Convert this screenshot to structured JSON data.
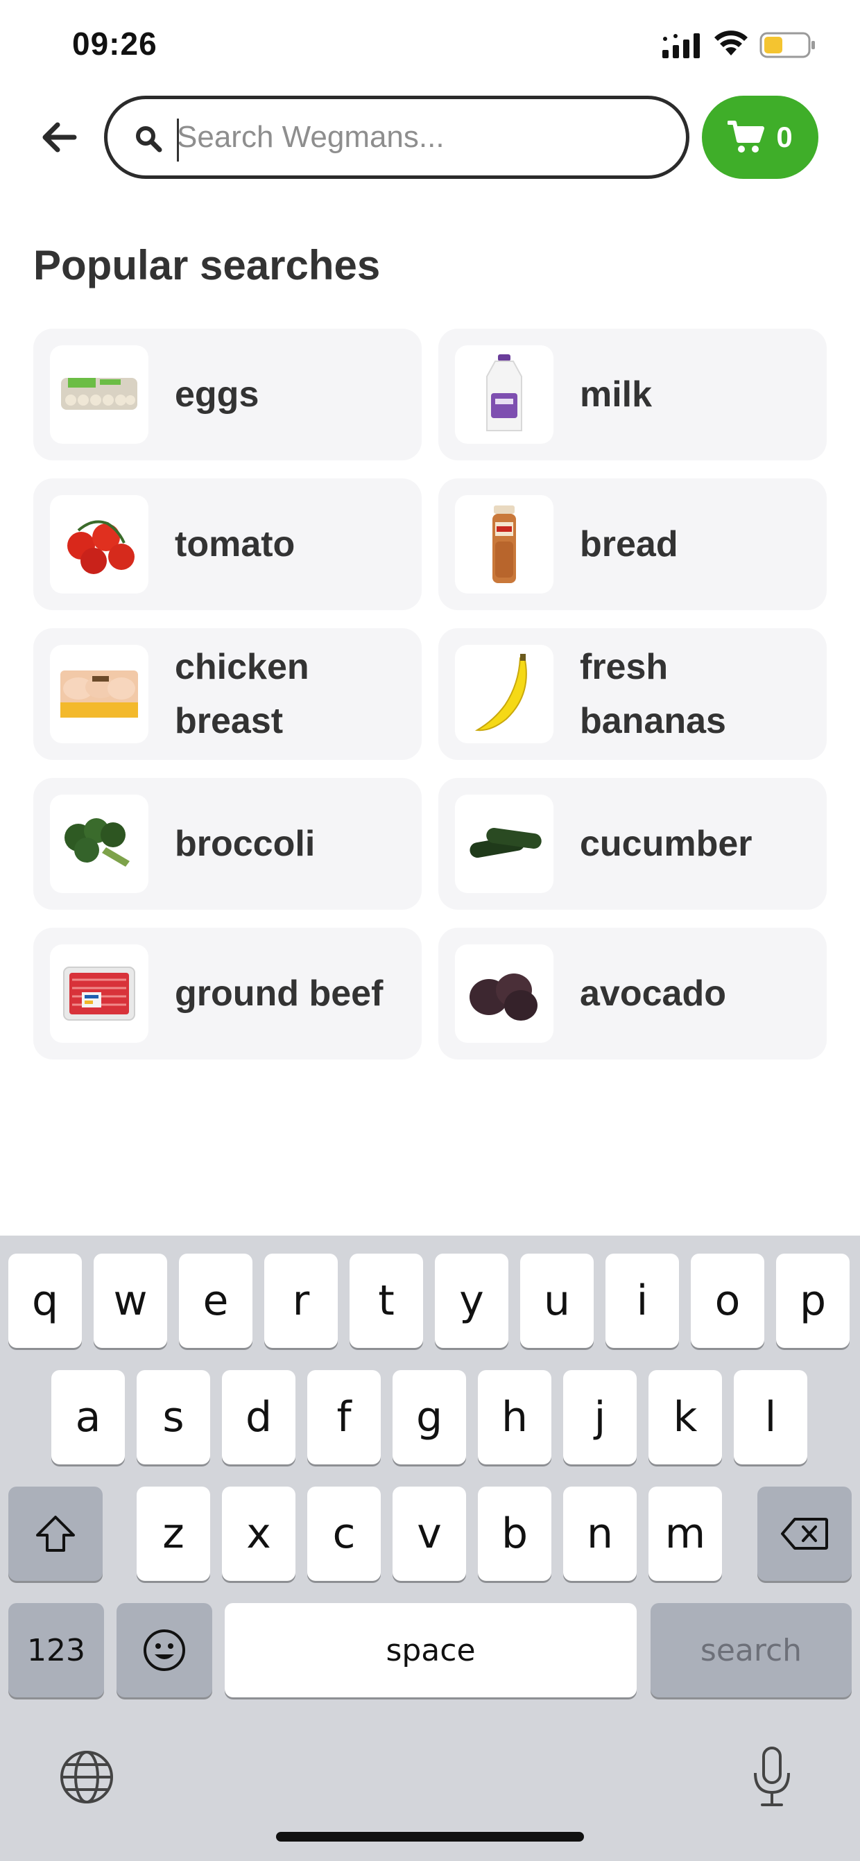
{
  "status_bar": {
    "time": "09:26",
    "icons": [
      "cellular-signal-icon",
      "wifi-icon",
      "battery-icon"
    ],
    "battery_color": "#f4c430"
  },
  "header": {
    "back_icon": "arrow-left-icon",
    "search": {
      "placeholder": "Search Wegmans...",
      "value": "",
      "icon": "search-icon"
    },
    "cart": {
      "icon": "cart-icon",
      "count": "0",
      "color": "#3fae29"
    }
  },
  "popular": {
    "title": "Popular searches",
    "items": [
      {
        "label": "eggs",
        "icon": "eggs-carton-icon"
      },
      {
        "label": "milk",
        "icon": "milk-jug-icon"
      },
      {
        "label": "tomato",
        "icon": "tomato-icon"
      },
      {
        "label": "bread",
        "icon": "bread-loaf-icon"
      },
      {
        "label": "chicken breast",
        "icon": "chicken-breast-pack-icon"
      },
      {
        "label": "fresh bananas",
        "icon": "banana-icon"
      },
      {
        "label": "broccoli",
        "icon": "broccoli-icon"
      },
      {
        "label": "cucumber",
        "icon": "cucumber-icon"
      },
      {
        "label": "ground beef",
        "icon": "ground-beef-pack-icon"
      },
      {
        "label": "avocado",
        "icon": "avocado-icon"
      }
    ]
  },
  "keyboard": {
    "row1": [
      "q",
      "w",
      "e",
      "r",
      "t",
      "y",
      "u",
      "i",
      "o",
      "p"
    ],
    "row2": [
      "a",
      "s",
      "d",
      "f",
      "g",
      "h",
      "j",
      "k",
      "l"
    ],
    "row3": [
      "z",
      "x",
      "c",
      "v",
      "b",
      "n",
      "m"
    ],
    "numbers_label": "123",
    "space_label": "space",
    "search_label": "search",
    "icons": [
      "shift-icon",
      "backspace-icon",
      "emoji-icon",
      "globe-icon",
      "microphone-icon"
    ]
  }
}
